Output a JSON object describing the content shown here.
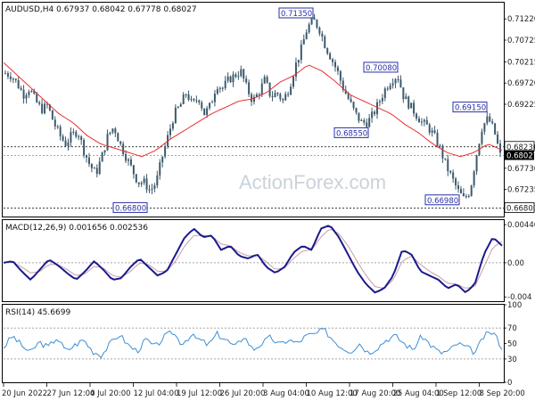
{
  "chart_data": [
    {
      "type": "candlestick",
      "title": "AUDUSD,H4  0.67937  0.68042  0.67778  0.68027",
      "ylim": [
        0.666,
        0.716
      ],
      "y_ticks": [
        "0.71220",
        "0.70725",
        "0.70215",
        "0.69720",
        "0.69225",
        "0.68230",
        "0.67730",
        "0.67235"
      ],
      "last_price": "0.68027",
      "price_levels": [
        {
          "value": 0.6823,
          "label": "0.68230"
        },
        {
          "value": 0.668,
          "label": "0.66800"
        }
      ],
      "annotations": [
        {
          "label": "0.71350",
          "value": 0.7135
        },
        {
          "label": "0.70080",
          "value": 0.7008
        },
        {
          "label": "0.69150",
          "value": 0.6915
        },
        {
          "label": "0.68550",
          "value": 0.6855
        },
        {
          "label": "0.66980",
          "value": 0.6698
        },
        {
          "label": "0.66800",
          "value": 0.668
        }
      ],
      "close_anchors": [
        0.6995,
        0.699,
        0.697,
        0.6945,
        0.696,
        0.693,
        0.691,
        0.692,
        0.688,
        0.685,
        0.683,
        0.685,
        0.686,
        0.6815,
        0.678,
        0.676,
        0.68,
        0.685,
        0.687,
        0.683,
        0.68,
        0.677,
        0.674,
        0.674,
        0.672,
        0.674,
        0.68,
        0.685,
        0.69,
        0.692,
        0.695,
        0.692,
        0.694,
        0.69,
        0.692,
        0.697,
        0.696,
        0.698,
        0.699,
        0.7,
        0.696,
        0.693,
        0.695,
        0.698,
        0.694,
        0.695,
        0.693,
        0.696,
        0.701,
        0.705,
        0.71,
        0.712,
        0.71,
        0.706,
        0.703,
        0.7,
        0.696,
        0.693,
        0.69,
        0.688,
        0.688,
        0.69,
        0.693,
        0.696,
        0.698,
        0.699,
        0.694,
        0.692,
        0.69,
        0.688,
        0.687,
        0.685,
        0.682,
        0.678,
        0.675,
        0.672,
        0.67,
        0.672,
        0.68,
        0.687,
        0.689,
        0.686,
        0.6803
      ],
      "ma_anchors": [
        0.702,
        0.699,
        0.696,
        0.693,
        0.69,
        0.688,
        0.685,
        0.683,
        0.682,
        0.681,
        0.68,
        0.6815,
        0.684,
        0.686,
        0.688,
        0.69,
        0.6915,
        0.693,
        0.6935,
        0.695,
        0.6975,
        0.699,
        0.7015,
        0.7,
        0.6975,
        0.6945,
        0.693,
        0.6915,
        0.69,
        0.6875,
        0.6855,
        0.683,
        0.681,
        0.68,
        0.681,
        0.683,
        0.6815
      ]
    },
    {
      "type": "line",
      "title": "MACD(12,26,9) 0.001656 0.002536",
      "ylim": [
        -0.0045,
        0.005
      ],
      "y_ticks": [
        "0.004469",
        "0.00",
        "-0.004"
      ],
      "macd_anchors": [
        0.0,
        0.0002,
        -0.001,
        -0.002,
        -0.0008,
        0.0004,
        -0.0003,
        -0.0012,
        -0.002,
        -0.001,
        0.0002,
        -0.0008,
        -0.002,
        -0.0018,
        -0.0005,
        0.0005,
        -0.0005,
        -0.0015,
        -0.001,
        0.001,
        0.003,
        0.004,
        0.003,
        0.0032,
        0.0015,
        0.002,
        0.0008,
        0.0005,
        0.001,
        -0.0005,
        -0.0012,
        -0.0005,
        0.0012,
        0.002,
        0.0015,
        0.004,
        0.0044,
        0.003,
        0.001,
        -0.001,
        -0.0025,
        -0.0035,
        -0.003,
        -0.0015,
        0.0015,
        0.001,
        -0.001,
        -0.0015,
        -0.002,
        -0.003,
        -0.0025,
        -0.0035,
        -0.0025,
        0.001,
        0.003,
        0.002
      ],
      "signal_anchors": [
        0.0,
        0.0001,
        -0.0005,
        -0.0012,
        -0.001,
        -0.0002,
        -0.0002,
        -0.0008,
        -0.0015,
        -0.0013,
        -0.0004,
        -0.0006,
        -0.0015,
        -0.0017,
        -0.001,
        0.0,
        -0.0002,
        -0.001,
        -0.001,
        0.0002,
        0.002,
        0.0032,
        0.0032,
        0.0031,
        0.0022,
        0.002,
        0.0012,
        0.0008,
        0.0009,
        0.0001,
        -0.0008,
        -0.0006,
        0.0005,
        0.0014,
        0.0015,
        0.003,
        0.004,
        0.0034,
        0.002,
        0.0002,
        -0.0015,
        -0.0028,
        -0.003,
        -0.002,
        0.0002,
        0.0008,
        -0.0002,
        -0.001,
        -0.0016,
        -0.0024,
        -0.0025,
        -0.003,
        -0.0028,
        -0.0005,
        0.0018,
        0.0025
      ]
    },
    {
      "type": "line",
      "title": "RSI(14) 45.6699",
      "ylim": [
        0,
        100
      ],
      "y_ticks": [
        "100",
        "70",
        "50",
        "30",
        "0"
      ],
      "rsi_anchors": [
        45,
        60,
        48,
        38,
        52,
        45,
        58,
        40,
        48,
        55,
        40,
        35,
        50,
        62,
        48,
        40,
        55,
        45,
        58,
        65,
        50,
        60,
        55,
        48,
        62,
        55,
        45,
        60,
        42,
        50,
        58,
        48,
        55,
        50,
        60,
        62,
        68,
        55,
        45,
        40,
        50,
        38,
        45,
        55,
        60,
        50,
        42,
        60,
        48,
        38,
        40,
        50,
        45,
        38,
        60,
        65,
        45
      ]
    }
  ],
  "x_labels": [
    "20 Jun 2022",
    "27 Jun 12:00",
    "4 Jul 20:00",
    "12 Jul 04:00",
    "19 Jul 12:00",
    "26 Jul 20:00",
    "3 Aug 04:00",
    "10 Aug 12:00",
    "17 Aug 20:00",
    "25 Aug 04:00",
    "1 Sep 12:00",
    "8 Sep 20:00"
  ],
  "watermark": "ActionForex.com",
  "colors": {
    "candle": "#3d5a6c",
    "ma": "#e83030",
    "macd": "#1a1a8c",
    "signal": "#c89ca8",
    "rsi": "#3d8fd6",
    "callout": "#2a2fa8"
  }
}
